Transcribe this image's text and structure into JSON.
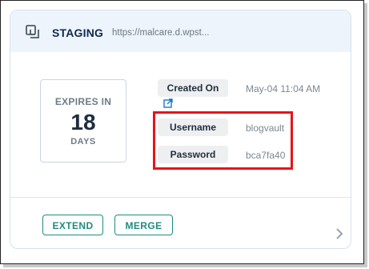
{
  "header": {
    "title": "STAGING",
    "url": "https://malcare.d.wpst...",
    "icon": "copy-icon"
  },
  "expiry": {
    "label": "EXPIRES IN",
    "number": "18",
    "unit": "DAYS"
  },
  "details": {
    "created_on_label": "Created On",
    "created_on_value": "May-04 11:04 AM",
    "external_link_icon": "external-link-icon",
    "username_label": "Username",
    "username_value": "blogvault",
    "password_label": "Password",
    "password_value": "bca7fa40"
  },
  "actions": {
    "extend_label": "EXTEND",
    "merge_label": "MERGE",
    "next_icon": "chevron-right-icon"
  },
  "colors": {
    "accent": "#1e8c80",
    "highlight": "#e8131b",
    "header_bg": "#eef4fb",
    "title": "#0e2a4d"
  }
}
